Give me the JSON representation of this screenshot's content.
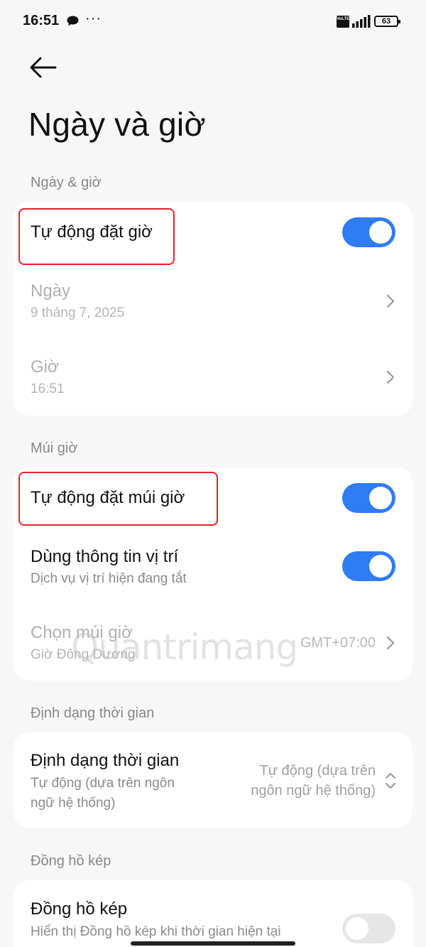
{
  "status_bar": {
    "time": "16:51",
    "more": "···",
    "volte": "VoLTE",
    "battery": "63"
  },
  "page": {
    "title": "Ngày và giờ",
    "accent_color": "#2f7cf5",
    "highlight_color": "#e0242f"
  },
  "sections": {
    "date_time": {
      "label": "Ngày & giờ",
      "auto_time": {
        "title": "Tự động đặt giờ",
        "enabled": true
      },
      "date": {
        "title": "Ngày",
        "value": "9 tháng 7, 2025"
      },
      "time": {
        "title": "Giờ",
        "value": "16:51"
      }
    },
    "timezone": {
      "label": "Múi giờ",
      "auto_timezone": {
        "title": "Tự động đặt múi giờ",
        "enabled": true
      },
      "use_location": {
        "title": "Dùng thông tin vị trí",
        "subtitle": "Dịch vụ vị trí hiện đang tắt",
        "enabled": true
      },
      "choose_timezone": {
        "title": "Chọn múi giờ",
        "subtitle": "Giờ Đông Dương",
        "value": "GMT+07:00"
      }
    },
    "time_format": {
      "label": "Định dạng thời gian",
      "format": {
        "title": "Định dạng thời gian",
        "subtitle_line1": "Tự động (dựa trên ngôn",
        "subtitle_line2": "ngữ hệ thống)",
        "value_line1": "Tự động (dựa trên",
        "value_line2": "ngôn ngữ hệ thống)"
      }
    },
    "dual_clock": {
      "label": "Đồng hồ kép",
      "dual_clock": {
        "title": "Đồng hồ kép",
        "subtitle": "Hiển thị Đồng hồ kép khi thời gian hiện tại",
        "enabled": false
      }
    }
  },
  "watermark": "Quantrimang"
}
